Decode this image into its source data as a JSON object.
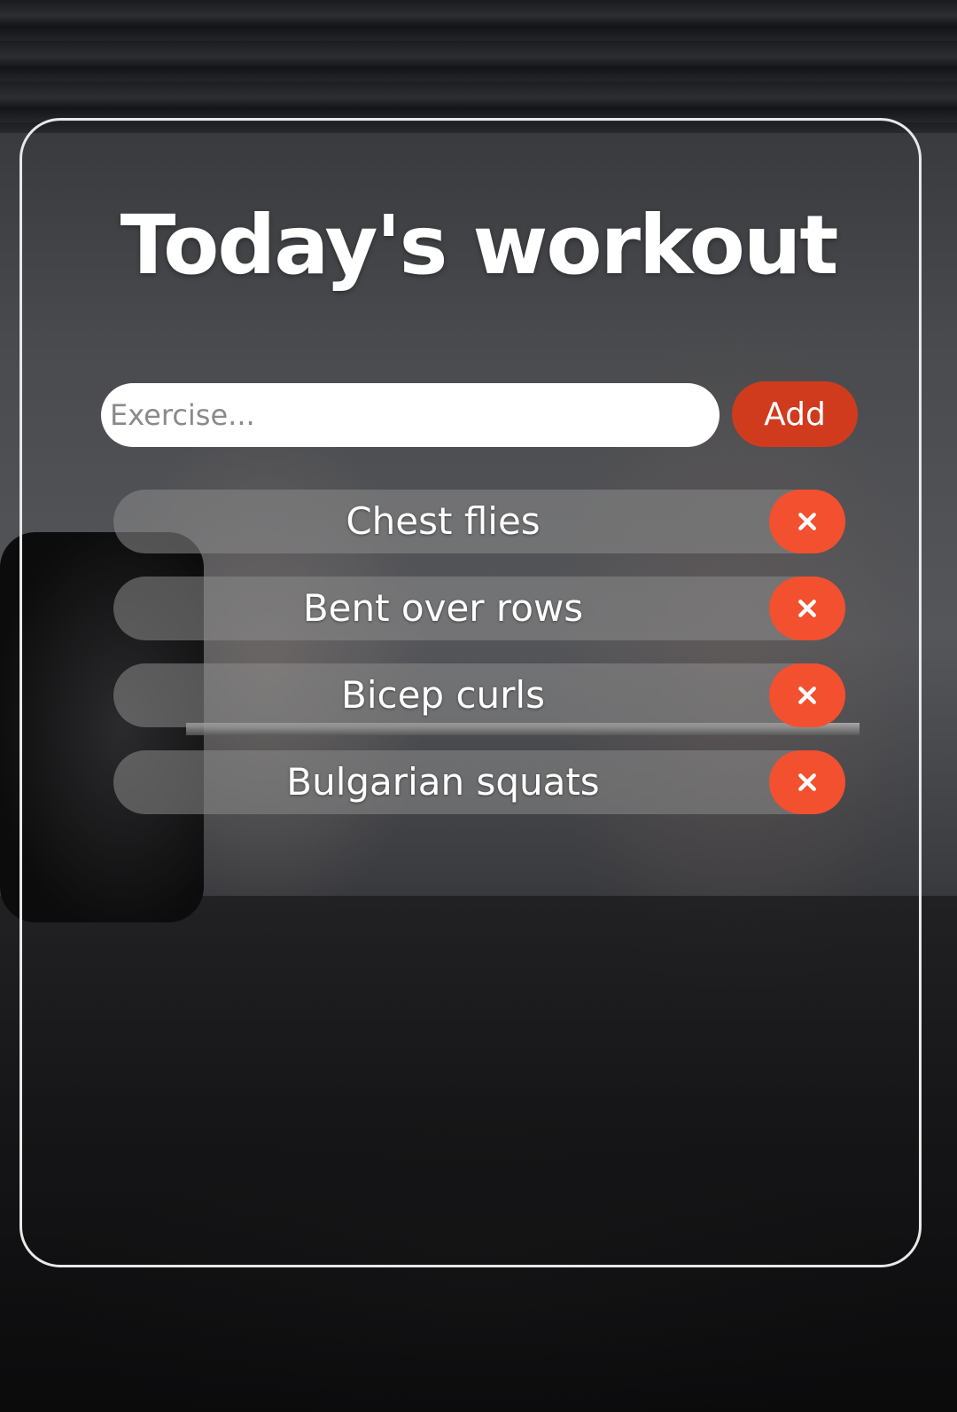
{
  "header": {
    "title": "Today's workout"
  },
  "form": {
    "input_value": "",
    "input_placeholder": "Exercise...",
    "add_label": "Add"
  },
  "exercises": [
    {
      "label": "Chest flies",
      "delete_icon": "close-icon"
    },
    {
      "label": "Bent over rows",
      "delete_icon": "close-icon"
    },
    {
      "label": "Bicep curls",
      "delete_icon": "close-icon"
    },
    {
      "label": "Bulgarian squats",
      "delete_icon": "close-icon"
    }
  ],
  "colors": {
    "add_button": "#d03b1e",
    "delete_button": "#f2502f",
    "item_background": "rgba(140,140,140,0.55)",
    "card_border": "#e8e8e8",
    "text": "#ffffff"
  }
}
